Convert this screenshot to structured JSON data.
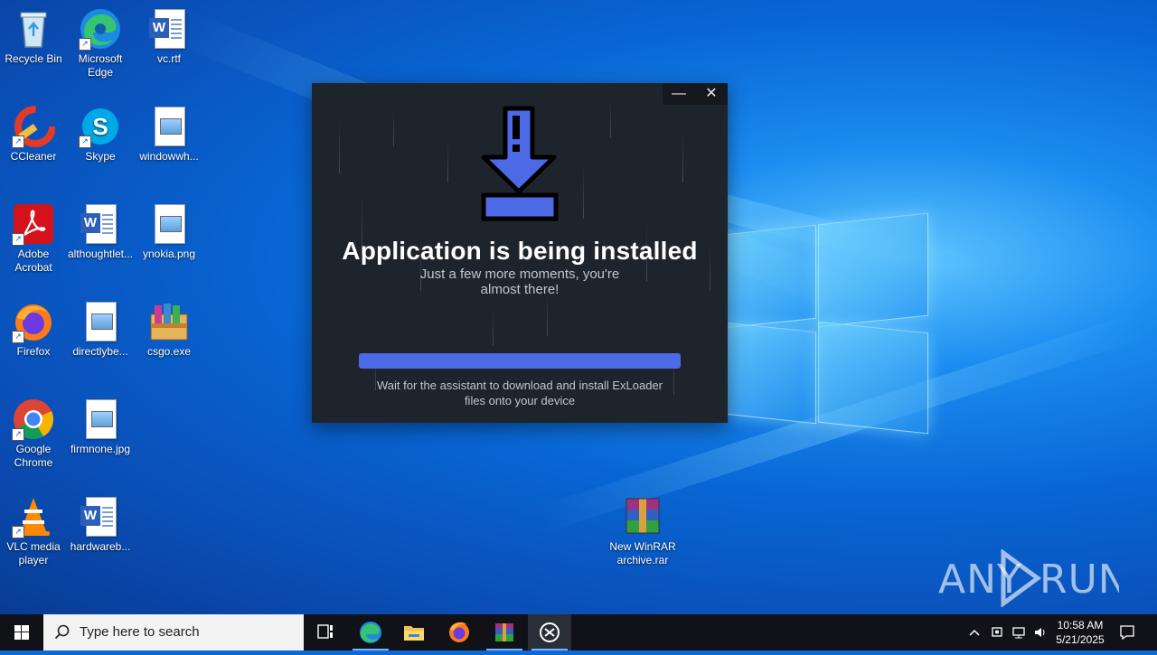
{
  "desktop": {
    "icons": [
      {
        "label": "Recycle Bin"
      },
      {
        "label": "Microsoft Edge"
      },
      {
        "label": "vc.rtf"
      },
      {
        "label": "CCleaner"
      },
      {
        "label": "Skype"
      },
      {
        "label": "windowwh..."
      },
      {
        "label": "Adobe Acrobat"
      },
      {
        "label": "althoughtlet..."
      },
      {
        "label": "ynokia.png"
      },
      {
        "label": "Firefox"
      },
      {
        "label": "directlybe..."
      },
      {
        "label": "csgo.exe"
      },
      {
        "label": "Google Chrome"
      },
      {
        "label": "firmnone.jpg"
      },
      {
        "label": "VLC media player"
      },
      {
        "label": "hardwareb..."
      },
      {
        "label": "New WinRAR archive.rar"
      }
    ]
  },
  "installer": {
    "minimize_icon": "minimize-icon",
    "close_icon": "close-icon",
    "headline": "Application is being installed",
    "subline": "Just a few more moments, you're almost there!",
    "progress": 1.0,
    "footnote": "Wait for the assistant to download and install ExLoader files onto your device",
    "accent": "#4c6ae6"
  },
  "taskbar": {
    "search_placeholder": "Type here to search",
    "time": "10:58 AM",
    "date": "5/21/2025",
    "apps": [
      "task-view-icon",
      "edge-icon",
      "file-explorer-icon",
      "firefox-icon",
      "winrar-icon",
      "exloader-icon"
    ]
  },
  "watermark": {
    "text": "ANY RUN"
  }
}
